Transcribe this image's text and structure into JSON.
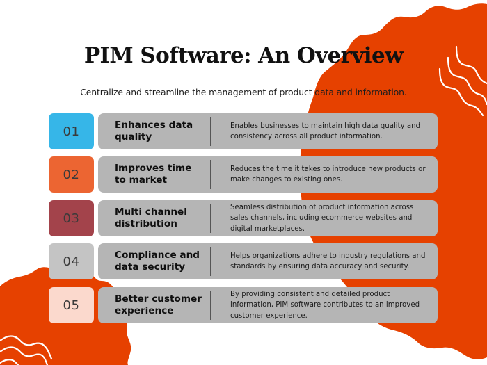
{
  "page": {
    "title": "PIM Software: An Overview",
    "subtitle": "Centralize and streamline the management of product data and information."
  },
  "colors": {
    "background": "#ffffff",
    "blob": "#e64100",
    "card": "#b5b5b5",
    "squiggle": "#ffffff"
  },
  "items": [
    {
      "number": "01",
      "title": "Enhances data quality",
      "description": "Enables businesses to maintain high data quality and consistency across all product information.",
      "color": "#36b6e8"
    },
    {
      "number": "02",
      "title": "Improves time to market",
      "description": "Reduces the time it takes to introduce new products or make changes to existing ones.",
      "color": "#ec6532"
    },
    {
      "number": "03",
      "title": "Multi channel distribution",
      "description": "Seamless distribution of product information across sales channels, including ecommerce websites and digital marketplaces.",
      "color": "#a3434b"
    },
    {
      "number": "04",
      "title": "Compliance and data security",
      "description": "Helps organizations adhere to industry regulations and standards by ensuring data accuracy and security.",
      "color": "#c4c4c4"
    },
    {
      "number": "05",
      "title": "Better customer experience",
      "description": "By providing consistent and detailed product information, PIM software contributes to an improved customer experience.",
      "color": "#fbd9cd"
    }
  ]
}
